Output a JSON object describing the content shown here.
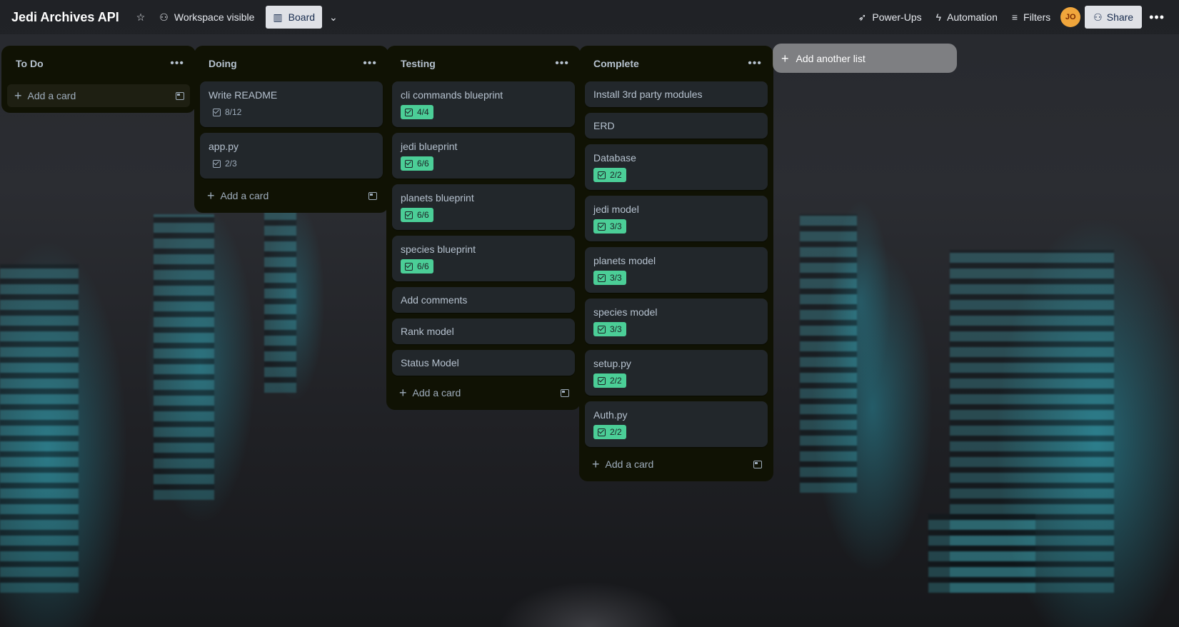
{
  "header": {
    "title": "Jedi Archives API",
    "visibility": "Workspace visible",
    "view": "Board",
    "power_ups": "Power-Ups",
    "automation": "Automation",
    "filters": "Filters",
    "avatar": "JO",
    "share": "Share"
  },
  "lists": [
    {
      "title": "To Do",
      "add_label": "Add a card",
      "cards": []
    },
    {
      "title": "Doing",
      "add_label": "Add a card",
      "cards": [
        {
          "title": "Write README",
          "checklist": "8/12",
          "complete": false
        },
        {
          "title": "app.py",
          "checklist": "2/3",
          "complete": false
        }
      ]
    },
    {
      "title": "Testing",
      "add_label": "Add a card",
      "cards": [
        {
          "title": "cli commands blueprint",
          "checklist": "4/4",
          "complete": true
        },
        {
          "title": "jedi blueprint",
          "checklist": "6/6",
          "complete": true
        },
        {
          "title": "planets blueprint",
          "checklist": "6/6",
          "complete": true
        },
        {
          "title": "species blueprint",
          "checklist": "6/6",
          "complete": true
        },
        {
          "title": "Add comments"
        },
        {
          "title": "Rank model"
        },
        {
          "title": "Status Model"
        }
      ]
    },
    {
      "title": "Complete",
      "add_label": "Add a card",
      "cards": [
        {
          "title": "Install 3rd party modules"
        },
        {
          "title": "ERD"
        },
        {
          "title": "Database",
          "checklist": "2/2",
          "complete": true
        },
        {
          "title": "jedi model",
          "checklist": "3/3",
          "complete": true
        },
        {
          "title": "planets model",
          "checklist": "3/3",
          "complete": true
        },
        {
          "title": "species model",
          "checklist": "3/3",
          "complete": true
        },
        {
          "title": "setup.py",
          "checklist": "2/2",
          "complete": true
        },
        {
          "title": "Auth.py",
          "checklist": "2/2",
          "complete": true
        }
      ]
    }
  ],
  "add_list_label": "Add another list",
  "colors": {
    "checklist_complete": "#4bce97",
    "list_bg": "#101204",
    "card_bg": "#22272b"
  }
}
